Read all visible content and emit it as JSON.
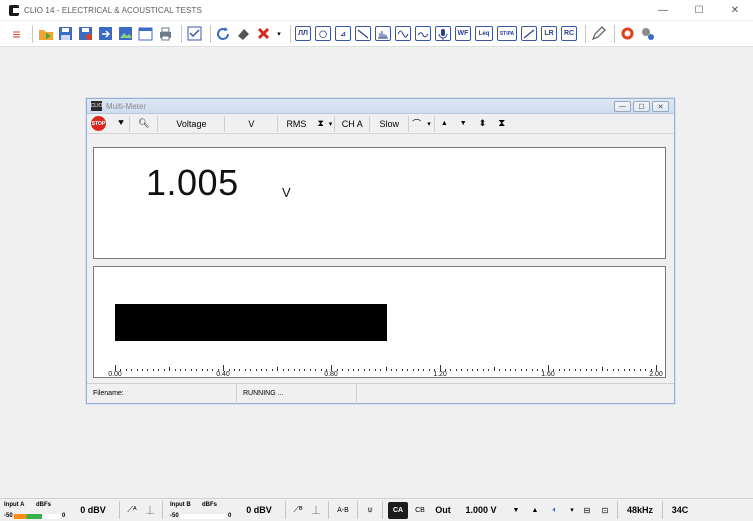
{
  "window": {
    "title": "CLIO 14 - ELECTRICAL & ACOUSTICAL TESTS",
    "min_glyph": "—",
    "max_glyph": "☐",
    "close_glyph": "✕"
  },
  "toolbar": {
    "menu_glyph": "≡",
    "mlsfft_label": "ЛЛ",
    "sinusoidal_label": "◯",
    "waterfall_label": "⊿",
    "wf_label": "WF",
    "leq_label": "Leq",
    "stipa_label": "STIPA",
    "lr_label": "LR",
    "rc_label": "RC"
  },
  "multimeter": {
    "title": "Multi-Meter",
    "logo_text": "CLIO",
    "stop_label": "STOP",
    "measure": "Voltage",
    "unit_select": "V",
    "mode": "RMS",
    "channel": "CH A",
    "speed": "Slow",
    "reading": "1.005",
    "reading_unit": "V",
    "bar_fraction": 0.5025,
    "scale_labels": [
      "0.00",
      "0.40",
      "0.80",
      "1.20",
      "1.60",
      "2.00"
    ],
    "status_filename_label": "Filename:",
    "status_state": "RUNNING ..."
  },
  "bottom": {
    "input_a_label": "Input A",
    "input_b_label": "Input B",
    "dbfs_label": "dBFs",
    "meter_min": "-50",
    "meter_max": "0",
    "input_a_level": "0 dBV",
    "input_b_level": "0 dBV",
    "a_minus_b": "A-B",
    "chA_label": "CA",
    "chB_label": "CB",
    "out_label": "Out",
    "out_level": "1.000 V",
    "sample_rate": "48kHz",
    "temperature": "34C"
  },
  "colors": {
    "accent": "#e0401e",
    "meter_green": "#33b24a",
    "meter_orange": "#ff8c1a",
    "bar": "#000000"
  }
}
